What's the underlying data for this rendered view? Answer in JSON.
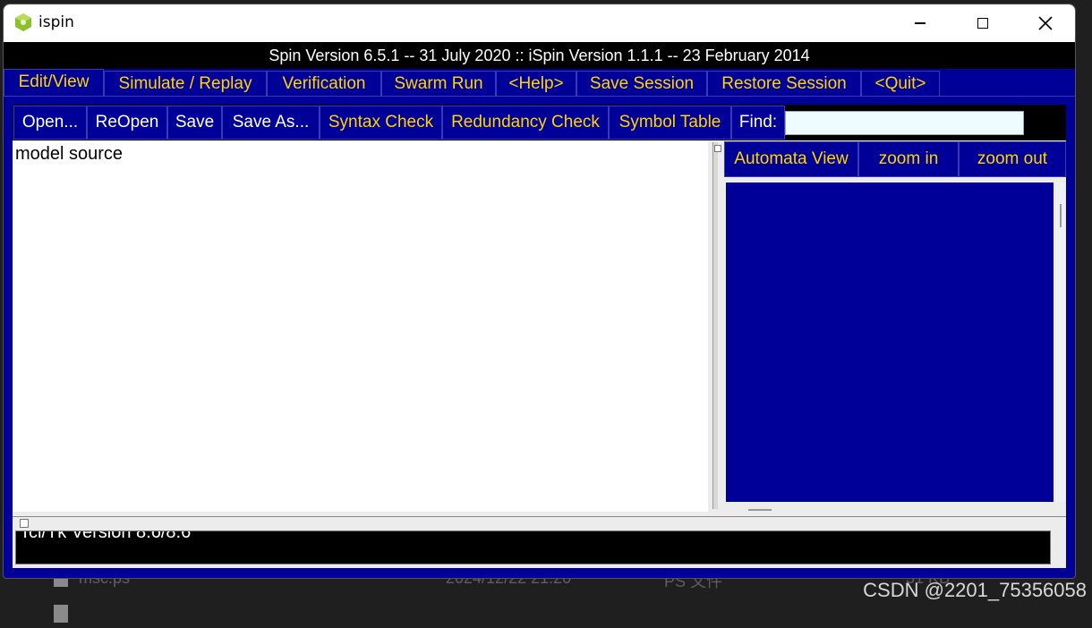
{
  "window": {
    "title": "ispin",
    "version_text": "Spin Version 6.5.1 -- 31 July 2020 :: iSpin Version 1.1.1 -- 23 February 2014"
  },
  "menu": {
    "tabs": [
      {
        "label": "Edit/View",
        "active": true
      },
      {
        "label": "Simulate / Replay"
      },
      {
        "label": "Verification"
      },
      {
        "label": "Swarm Run"
      },
      {
        "label": "<Help>"
      },
      {
        "label": "Save Session"
      },
      {
        "label": "Restore Session"
      },
      {
        "label": "<Quit>"
      }
    ]
  },
  "toolbar": {
    "open": "Open...",
    "reopen": "ReOpen",
    "save": "Save",
    "save_as": "Save As...",
    "syntax_check": "Syntax Check",
    "redundancy_check": "Redundancy Check",
    "symbol_table": "Symbol Table",
    "find_label": "Find:",
    "find_value": ""
  },
  "editor": {
    "source_text": "model source"
  },
  "automata": {
    "view_label": "Automata View",
    "zoom_in": "zoom in",
    "zoom_out": "zoom out"
  },
  "log": {
    "text": "Tcl/Tk Version 8.6/8.6"
  },
  "background": {
    "file1_name": "msc.ps",
    "file1_date": "2024/12/22 21:20",
    "file1_type": "PS 文件",
    "file1_size": "31 KB",
    "watermark": "CSDN @2201_75356058"
  },
  "colors": {
    "window_bg": "#000098",
    "accent_text": "#ffd400",
    "title_bar": "#ffffff",
    "version_bar": "#000000",
    "app_icon": "#8dbf2e"
  },
  "icons": {
    "app": "ispin-app-icon",
    "minimize": "minimize-icon",
    "maximize": "maximize-icon",
    "close": "close-icon"
  }
}
